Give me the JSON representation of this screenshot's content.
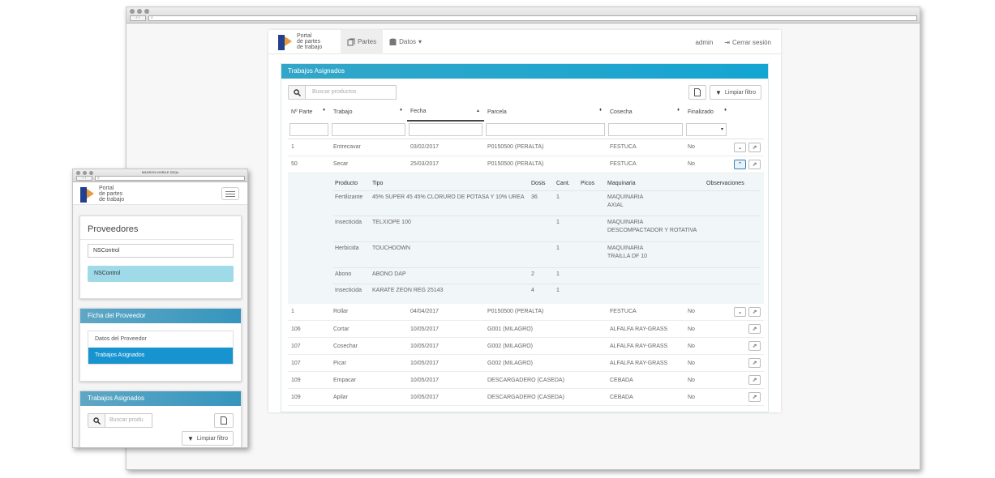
{
  "colors": {
    "accent": "#14a5d2",
    "brand_blue": "#23408e",
    "brand_orange": "#e89a3c"
  },
  "nav": {
    "logo_line1": "Portal",
    "logo_line2": "de partes",
    "logo_line3": "de trabajo",
    "tab_partes": "Partes",
    "tab_datos": "Datos",
    "user": "admin",
    "logout": "Cerrar sesión"
  },
  "panel": {
    "title": "Trabajos Asignados",
    "search_placeholder": "Buscar productos",
    "clear_filter": "Limpiar filtro"
  },
  "columns": [
    "Nº Parte",
    "Trabajo",
    "Fecha",
    "Parcela",
    "Cosecha",
    "Finalizado"
  ],
  "rows": [
    {
      "n": "1",
      "trabajo": "Entrecavar",
      "fecha": "03/02/2017",
      "parcela": "P0150500 (PERALTA)",
      "cosecha": "FESTUCA",
      "fin": "No"
    },
    {
      "n": "50",
      "trabajo": "Secar",
      "fecha": "25/03/2017",
      "parcela": "P0150500 (PERALTA)",
      "cosecha": "FESTUCA",
      "fin": "No"
    },
    {
      "n": "1",
      "trabajo": "Rollar",
      "fecha": "04/04/2017",
      "parcela": "P0150500 (PERALTA)",
      "cosecha": "FESTUCA",
      "fin": "No"
    },
    {
      "n": "106",
      "trabajo": "Cortar",
      "fecha": "10/05/2017",
      "parcela": "G001 (MILAGRO)",
      "cosecha": "ALFALFA RAY-GRASS",
      "fin": "No"
    },
    {
      "n": "107",
      "trabajo": "Cosechar",
      "fecha": "10/05/2017",
      "parcela": "G002 (MILAGRO)",
      "cosecha": "ALFALFA RAY-GRASS",
      "fin": "No"
    },
    {
      "n": "107",
      "trabajo": "Picar",
      "fecha": "10/05/2017",
      "parcela": "G002 (MILAGRO)",
      "cosecha": "ALFALFA RAY-GRASS",
      "fin": "No"
    },
    {
      "n": "109",
      "trabajo": "Empacar",
      "fecha": "10/05/2017",
      "parcela": "DESCARGADERO (CASEDA)",
      "cosecha": "CEBADA",
      "fin": "No"
    },
    {
      "n": "109",
      "trabajo": "Apilar",
      "fecha": "10/05/2017",
      "parcela": "DESCARGADERO (CASEDA)",
      "cosecha": "CEBADA",
      "fin": "No"
    }
  ],
  "detail": {
    "columns": [
      "Producto",
      "Tipo",
      "Dosis",
      "Cant.",
      "Picos",
      "Maquinaria",
      "Observaciones"
    ],
    "rows": [
      {
        "producto": "Fertilizante",
        "tipo": "45% SUPER 45 45% CLORURO DE POTASA Y 10% UREA",
        "dosis": "36",
        "cant": "1",
        "maq1": "MAQUINARIA",
        "maq2": "AXIAL"
      },
      {
        "producto": "Insecticida",
        "tipo": "TELXIOPE 100",
        "dosis": "",
        "cant": "1",
        "maq1": "MAQUINARIA",
        "maq2": "DESCOMPACTADOR Y ROTATIVA"
      },
      {
        "producto": "Herbicida",
        "tipo": "TOUCHDOWN",
        "dosis": "",
        "cant": "1",
        "maq1": "MAQUINARIA",
        "maq2": "TRAILLA DF 10"
      },
      {
        "producto": "Abono",
        "tipo": "ABONO DAP",
        "dosis": "2",
        "cant": "1",
        "maq1": "",
        "maq2": ""
      },
      {
        "producto": "Insecticida",
        "tipo": "KARATE ZEON REG 25143",
        "dosis": "4",
        "cant": "1",
        "maq1": "",
        "maq2": ""
      }
    ]
  },
  "mobile": {
    "window_title": "MANSON MOBILE DEQs",
    "proveedores_title": "Proveedores",
    "provider_input": "NSControl",
    "provider_selected": "NSControl",
    "ficha_title": "Ficha del Proveedor",
    "menu_datos": "Datos del Proveedor",
    "menu_trabajos": "Trabajos Asignados",
    "trabajos_title": "Trabajos Asignados",
    "search_placeholder": "Buscar produ",
    "clear_filter": "Limpiar filtro"
  }
}
